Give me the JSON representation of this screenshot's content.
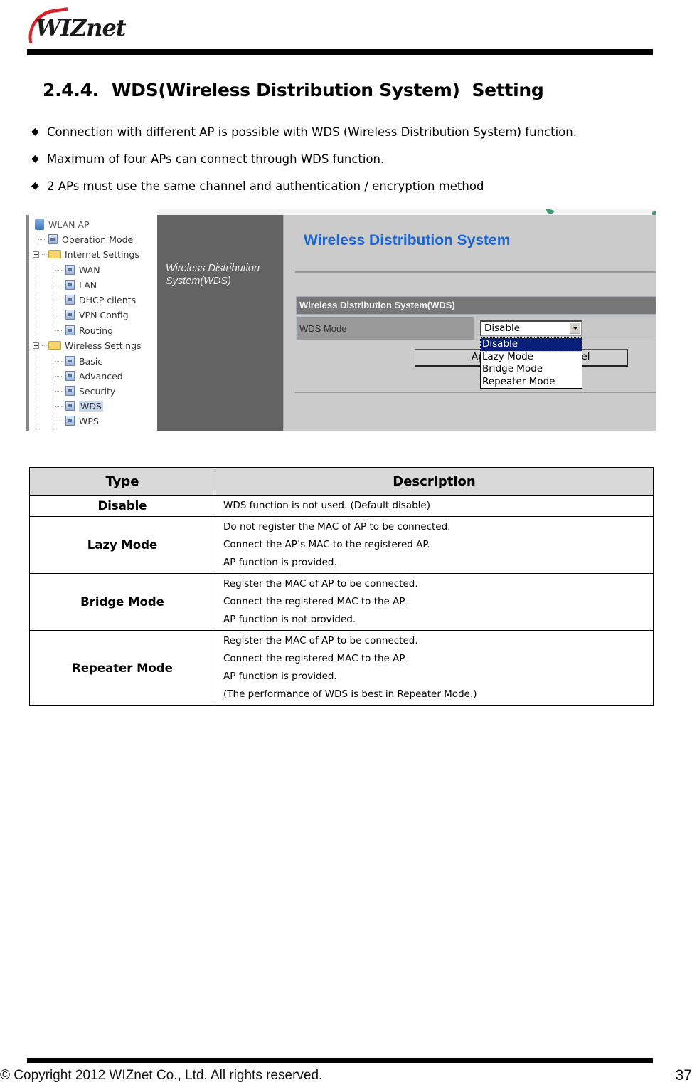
{
  "header": {
    "logo_text": "WIZnet"
  },
  "section": {
    "number": "2.4.4.",
    "title": "WDS(Wireless Distribution System)  Setting"
  },
  "bullets": [
    "Connection with different AP is possible with WDS (Wireless Distribution System) function.",
    "Maximum of four APs can connect through WDS function.",
    "2 APs must use the same channel and authentication / encryption method"
  ],
  "bullet_glyph": "◆",
  "screenshot": {
    "tree": {
      "root": "WLAN AP",
      "items": [
        {
          "label": "Operation Mode",
          "level": 1,
          "type": "page"
        },
        {
          "label": "Internet Settings",
          "level": 1,
          "type": "folder",
          "expanded": true
        },
        {
          "label": "WAN",
          "level": 2,
          "type": "page"
        },
        {
          "label": "LAN",
          "level": 2,
          "type": "page"
        },
        {
          "label": "DHCP clients",
          "level": 2,
          "type": "page"
        },
        {
          "label": "VPN Config",
          "level": 2,
          "type": "page"
        },
        {
          "label": "Routing",
          "level": 2,
          "type": "page"
        },
        {
          "label": "Wireless Settings",
          "level": 1,
          "type": "folder",
          "expanded": true
        },
        {
          "label": "Basic",
          "level": 2,
          "type": "page"
        },
        {
          "label": "Advanced",
          "level": 2,
          "type": "page"
        },
        {
          "label": "Security",
          "level": 2,
          "type": "page"
        },
        {
          "label": "WDS",
          "level": 2,
          "type": "page",
          "selected": true
        },
        {
          "label": "WPS",
          "level": 2,
          "type": "page"
        }
      ]
    },
    "side_title_line1": "Wireless Distribution",
    "side_title_line2": "System(WDS)",
    "page_title": "Wireless Distribution System",
    "table_header": "Wireless Distribution System(WDS)",
    "wds_mode_label": "WDS Mode",
    "wds_mode_value": "Disable",
    "dropdown_options": [
      "Disable",
      "Lazy Mode",
      "Bridge Mode",
      "Repeater Mode"
    ],
    "dropdown_highlighted": "Disable",
    "apply_label": "Apply",
    "cancel_label": "Cancel",
    "cancel_visible_text": "cel",
    "colors": {
      "title_blue": "#1a64d4",
      "side_panel": "#636363",
      "highlight": "#0a1f7a"
    }
  },
  "table": {
    "headers": [
      "Type",
      "Description"
    ],
    "rows": [
      {
        "type": "Disable",
        "desc": [
          "WDS function is not used. (Default disable)"
        ]
      },
      {
        "type": "Lazy Mode",
        "desc": [
          "Do not register the MAC of AP to be connected.",
          "Connect the AP’s MAC to the registered AP.",
          "AP function is provided."
        ]
      },
      {
        "type": "Bridge Mode",
        "desc": [
          "Register the MAC of AP to be connected.",
          "Connect the registered MAC to the AP.",
          "AP function is not provided."
        ]
      },
      {
        "type": "Repeater Mode",
        "desc": [
          "Register the MAC of AP to be connected.",
          "Connect the registered MAC to the AP.",
          "AP function is provided.",
          "(The performance of WDS is best in Repeater Mode.)"
        ]
      }
    ]
  },
  "footer": {
    "copyright": "© Copyright 2012 WIZnet Co., Ltd. All rights reserved.",
    "page_number": "37"
  }
}
